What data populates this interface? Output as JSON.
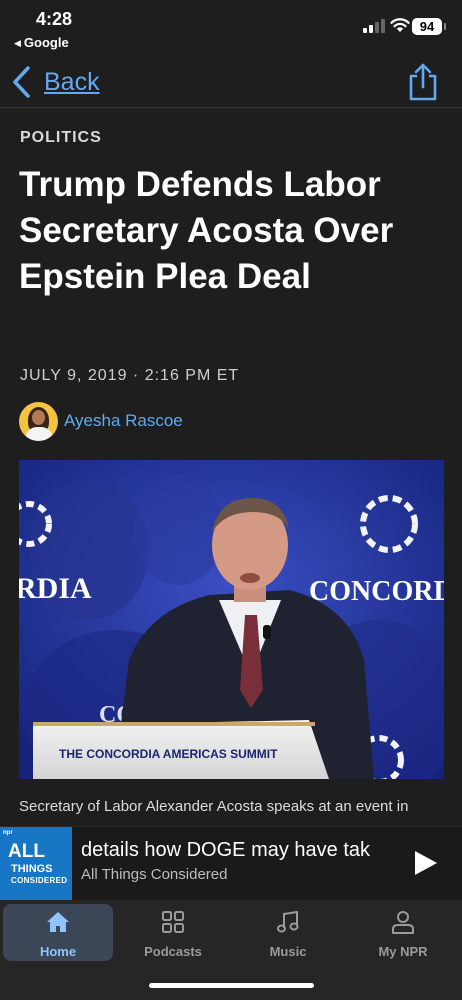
{
  "status_bar": {
    "time": "4:28",
    "back_app": "Google",
    "battery": "94"
  },
  "nav": {
    "back_label": "Back"
  },
  "article": {
    "kicker": "POLITICS",
    "headline": "Trump Defends Labor Secretary Acosta Over Epstein Plea Deal",
    "dateline": "JULY 9, 2019 · 2:16 PM ET",
    "author": "Ayesha Rascoe",
    "photo_sign_text": "THE CONCORDIA AMERICAS SUMMIT",
    "photo_backdrop_left": "RDIA",
    "photo_backdrop_right": "CONCORD",
    "photo_lower_left": "CO",
    "caption": "Secretary of Labor Alexander Acosta speaks at an event in Bogotá, Colombia, in May. Acosta is coming under criticism"
  },
  "player": {
    "show_art": {
      "npr": "npr",
      "all": "ALL",
      "things": "THINGS",
      "considered": "CONSIDERED"
    },
    "track_title": "details how DOGE may have tak",
    "program": "All Things Considered"
  },
  "tabs": [
    {
      "label": "Home",
      "icon": "home-icon",
      "active": true
    },
    {
      "label": "Podcasts",
      "icon": "podcasts-grid-icon",
      "active": false
    },
    {
      "label": "Music",
      "icon": "music-note-icon",
      "active": false
    },
    {
      "label": "My NPR",
      "icon": "person-icon",
      "active": false
    }
  ],
  "colors": {
    "background": "#1e1e1e",
    "link": "#62a9f0",
    "active_tab": "#3b4656",
    "active_tab_label": "#8ec4ff",
    "show_art": "#1777c4"
  }
}
